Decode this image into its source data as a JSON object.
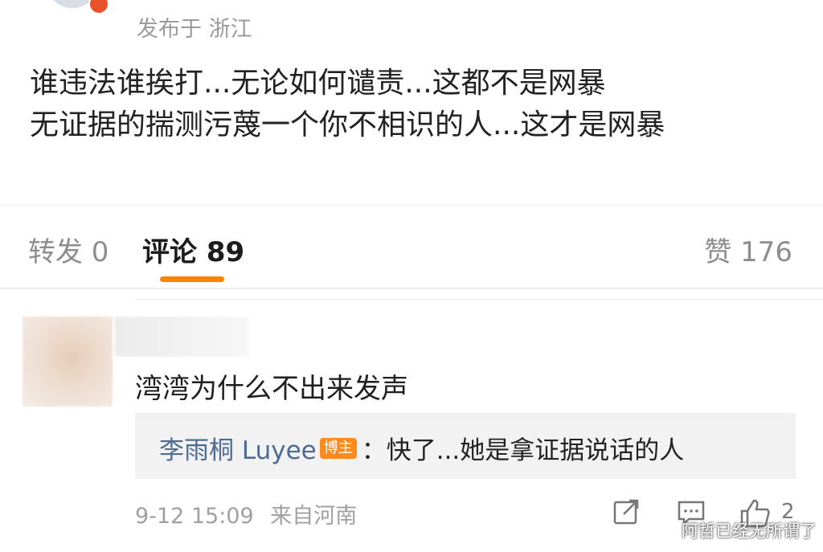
{
  "post": {
    "location": "发布于 浙江",
    "content": [
      "谁违法谁挨打...无论如何谴责...这都不是网暴",
      "无证据的揣测污蔑一个你不相识的人...这才是网暴"
    ]
  },
  "tabs": {
    "forward": "转发 0",
    "comments": "评论 89",
    "likes": "赞 176"
  },
  "comment": {
    "text": "湾湾为什么不出来发声",
    "reply": {
      "author": "李雨桐 Luyee",
      "badge": "博主",
      "text": "：快了...她是拿证据说话的人"
    },
    "time": "9-12 15:09",
    "source": "来自河南",
    "like_count": "2"
  },
  "watermark": "阿哲已经无所谓了",
  "colors": {
    "accent": "#ff8200",
    "link": "#4e6b93",
    "badge": "#ff8a1e"
  }
}
